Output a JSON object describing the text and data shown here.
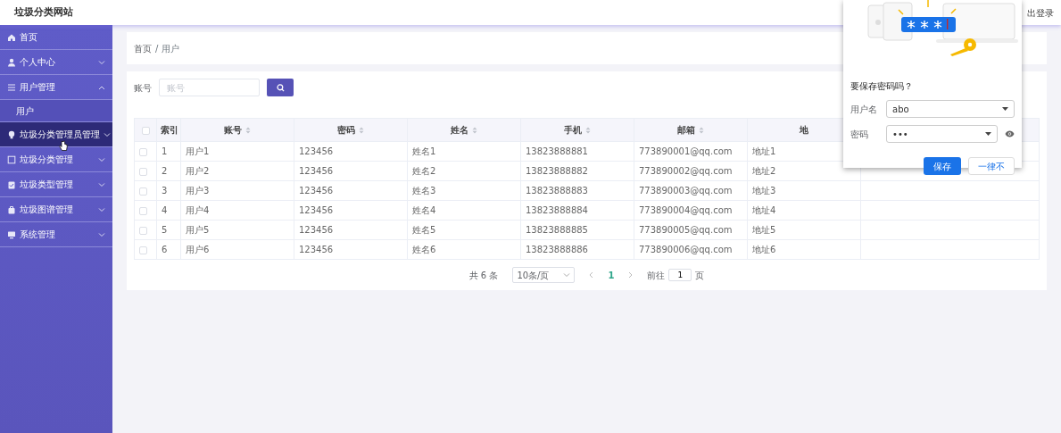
{
  "header": {
    "title": "垃圾分类网站",
    "logout": "出登录"
  },
  "sidebar": {
    "items": [
      {
        "label": "首页",
        "kind": "home",
        "hovered": false
      },
      {
        "label": "个人中心",
        "kind": "user",
        "expanded": false,
        "hovered": false
      },
      {
        "label": "用户管理",
        "kind": "menu",
        "expanded": true,
        "hovered": false,
        "children": [
          {
            "label": "用户"
          }
        ]
      },
      {
        "label": "垃圾分类管理员管理",
        "kind": "bulb",
        "expanded": false,
        "hovered": true
      },
      {
        "label": "垃圾分类管理",
        "kind": "square",
        "expanded": false,
        "hovered": false
      },
      {
        "label": "垃圾类型管理",
        "kind": "clipboard",
        "expanded": false,
        "hovered": false
      },
      {
        "label": "垃圾图谱管理",
        "kind": "bag",
        "expanded": false,
        "hovered": false
      },
      {
        "label": "系统管理",
        "kind": "monitor",
        "expanded": false,
        "hovered": false
      }
    ]
  },
  "breadcrumb": {
    "items": [
      "首页",
      "用户"
    ],
    "separator": "/"
  },
  "search": {
    "label": "账号",
    "placeholder": "账号"
  },
  "table": {
    "all_checked": false,
    "columns": [
      {
        "label": "索引",
        "sortable": false
      },
      {
        "label": "账号",
        "sortable": true
      },
      {
        "label": "密码",
        "sortable": true
      },
      {
        "label": "姓名",
        "sortable": true
      },
      {
        "label": "手机",
        "sortable": true
      },
      {
        "label": "邮箱",
        "sortable": true
      },
      {
        "label": "地",
        "sortable": false
      }
    ],
    "rows": [
      {
        "checked": false,
        "cells": [
          "1",
          "用户1",
          "123456",
          "姓名1",
          "13823888881",
          "773890001@qq.com",
          "地址1"
        ]
      },
      {
        "checked": false,
        "cells": [
          "2",
          "用户2",
          "123456",
          "姓名2",
          "13823888882",
          "773890002@qq.com",
          "地址2"
        ]
      },
      {
        "checked": false,
        "cells": [
          "3",
          "用户3",
          "123456",
          "姓名3",
          "13823888883",
          "773890003@qq.com",
          "地址3"
        ]
      },
      {
        "checked": false,
        "cells": [
          "4",
          "用户4",
          "123456",
          "姓名4",
          "13823888884",
          "773890004@qq.com",
          "地址4"
        ]
      },
      {
        "checked": false,
        "cells": [
          "5",
          "用户5",
          "123456",
          "姓名5",
          "13823888885",
          "773890005@qq.com",
          "地址5"
        ]
      },
      {
        "checked": false,
        "cells": [
          "6",
          "用户6",
          "123456",
          "姓名6",
          "13823888886",
          "773890006@qq.com",
          "地址6"
        ]
      }
    ]
  },
  "pagination": {
    "total": "共 6 条",
    "page_size": "10条/页",
    "current": "1",
    "goto_label": "前往",
    "goto_value": "1",
    "page_unit": "页"
  },
  "password_popup": {
    "title": "要保存密码吗？",
    "username_label": "用户名",
    "username": "abo",
    "password_label": "密码",
    "password": "•••",
    "save": "保存",
    "never": "一律不"
  }
}
